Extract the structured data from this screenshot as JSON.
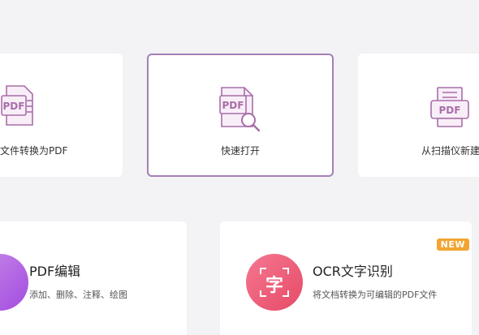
{
  "quick_actions": [
    {
      "label": "文件转换为PDF",
      "icon": "pdf-convert-icon"
    },
    {
      "label": "快速打开",
      "icon": "pdf-search-icon"
    },
    {
      "label": "从扫描仪新建",
      "icon": "pdf-scanner-icon"
    }
  ],
  "features": [
    {
      "title": "PDF编辑",
      "description": "添加、删除、注释、绘图",
      "icon": "pdf-edit-icon"
    },
    {
      "title": "OCR文字识别",
      "description": "将文档转换为可编辑的PDF文件",
      "icon": "ocr-icon",
      "glyph": "字",
      "badge": "NEW"
    }
  ],
  "icon_text": "PDF",
  "colors": {
    "accent": "#a57fb6",
    "icon_stroke": "#a86ea8",
    "badge": "#f2a531"
  }
}
